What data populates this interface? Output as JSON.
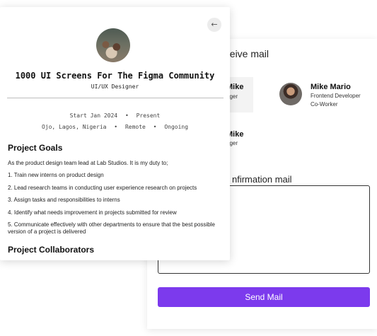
{
  "composer": {
    "heading_fragment": "eceive mail",
    "contact_left": {
      "name_fragment": "Mike",
      "role_fragment": "ager"
    },
    "contact_left_2": {
      "name_fragment": "Mike",
      "role_fragment": "ager"
    },
    "contact_right": {
      "name": "Mike Mario",
      "role": "Frontend Developer",
      "tag": "Co-Worker"
    },
    "confirmation_label_fragment": "nfirmation mail",
    "message_value": "",
    "send_label": "Send Mail",
    "accent_color": "#7c3aed"
  },
  "profile": {
    "back_icon": "←",
    "title": "1000 UI Screens For The Figma Community",
    "subtitle": "UI/UX Designer",
    "start": "Start Jan 2024",
    "end": "Present",
    "location": "Ojo, Lagos, Nigeria",
    "work_mode": "Remote",
    "status": "Ongoing",
    "bullet": "•",
    "project_goals_heading": "Project Goals",
    "goals_intro": "As the product design team lead at Lab Studios. It is my duty to;",
    "goals": [
      "1. Train new interns on product design",
      "2. Lead research teams in conducting user experience research on projects",
      "3. Assign tasks and responsibilities to interns",
      "4. Identify what needs improvement in projects submitted for review",
      "5. Communicate effectively with other departments to ensure that the best possible version of a project is delivered"
    ],
    "collaborators_heading": "Project Collaborators"
  }
}
